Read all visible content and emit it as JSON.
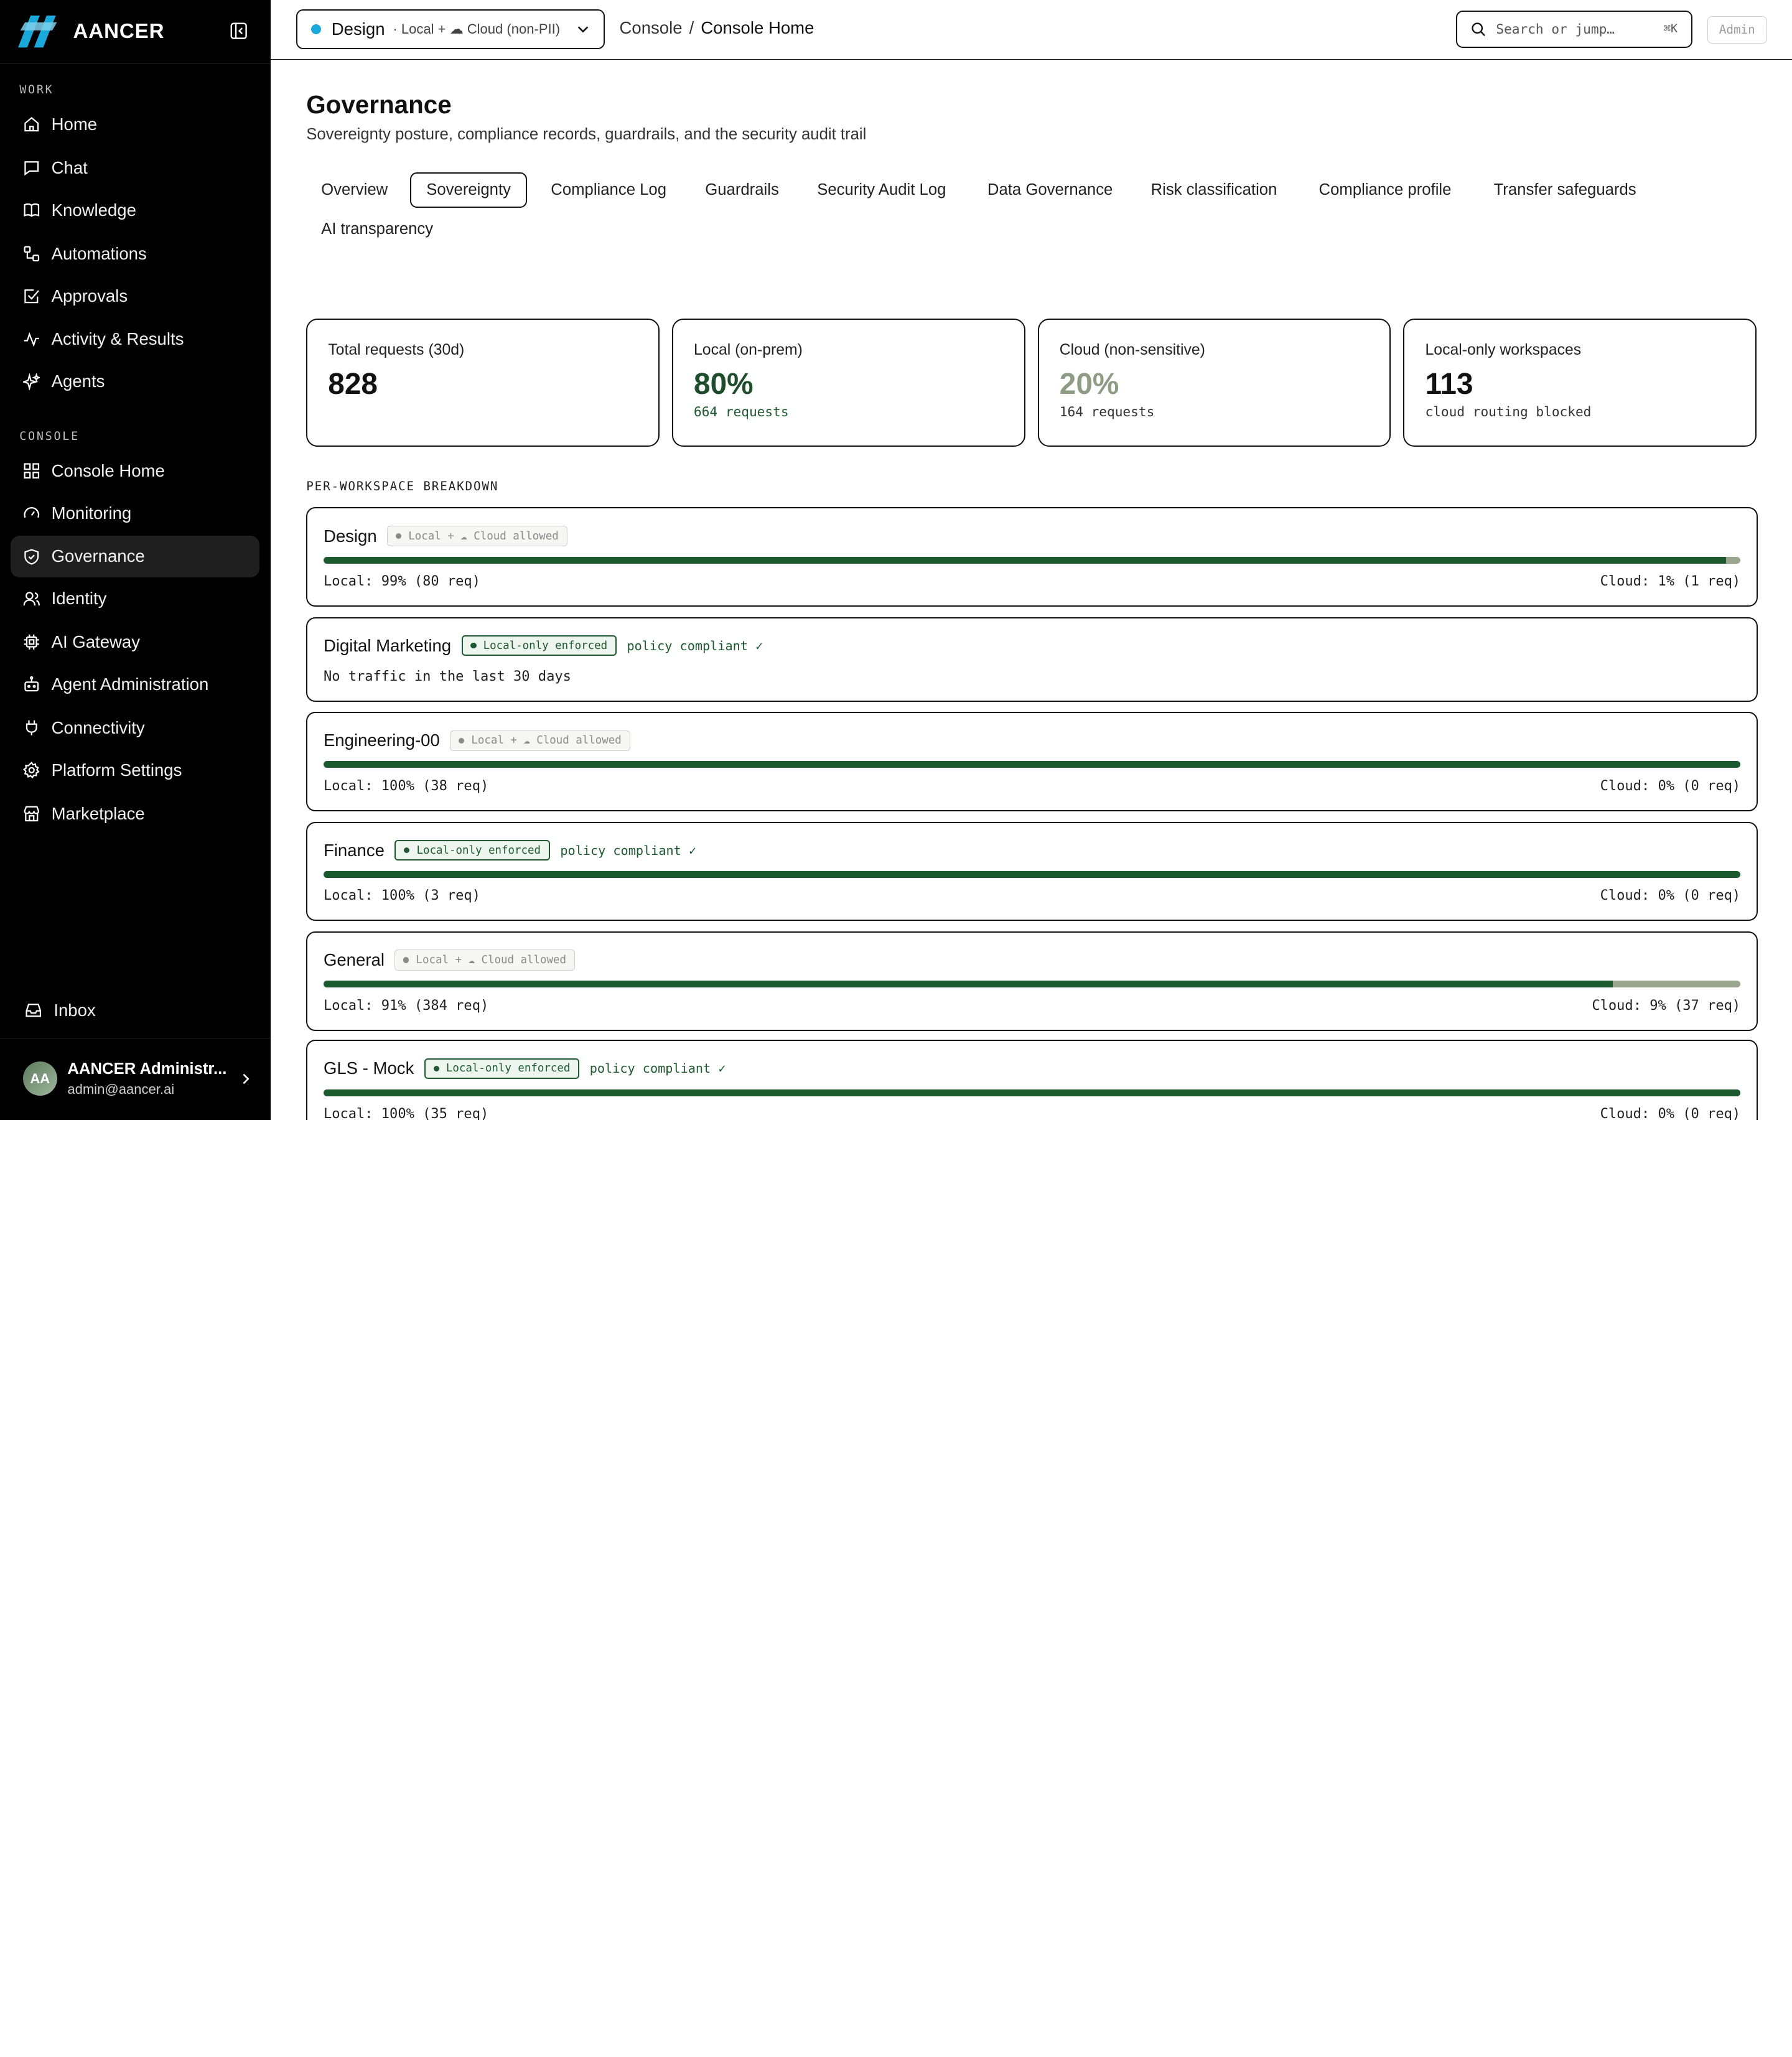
{
  "brand": {
    "name": "AANCER"
  },
  "sidebar": {
    "work_label": "WORK",
    "console_label": "CONSOLE",
    "work_items": [
      {
        "label": "Home",
        "icon": "home-icon"
      },
      {
        "label": "Chat",
        "icon": "chat-icon"
      },
      {
        "label": "Knowledge",
        "icon": "book-icon"
      },
      {
        "label": "Automations",
        "icon": "workflow-icon"
      },
      {
        "label": "Approvals",
        "icon": "check-square-icon"
      },
      {
        "label": "Activity & Results",
        "icon": "activity-icon"
      },
      {
        "label": "Agents",
        "icon": "sparkles-icon"
      }
    ],
    "console_items": [
      {
        "label": "Console Home",
        "icon": "grid-icon"
      },
      {
        "label": "Monitoring",
        "icon": "gauge-icon"
      },
      {
        "label": "Governance",
        "icon": "shield-icon",
        "active": true
      },
      {
        "label": "Identity",
        "icon": "users-icon"
      },
      {
        "label": "AI Gateway",
        "icon": "chip-icon"
      },
      {
        "label": "Agent Administration",
        "icon": "bot-icon"
      },
      {
        "label": "Connectivity",
        "icon": "plug-icon"
      },
      {
        "label": "Platform Settings",
        "icon": "gear-icon"
      },
      {
        "label": "Marketplace",
        "icon": "store-icon"
      }
    ],
    "inbox": {
      "label": "Inbox",
      "icon": "inbox-icon"
    },
    "user": {
      "initials": "AA",
      "name": "AANCER Administr...",
      "email": "admin@aancer.ai"
    }
  },
  "topbar": {
    "workspace": {
      "name": "Design",
      "mode": "· Local + ☁ Cloud (non-PII)",
      "dot_color": "#1aa7d9"
    },
    "breadcrumb": {
      "parent": "Console",
      "separator": "/",
      "current": "Console Home"
    },
    "search": {
      "placeholder": "Search or jump…",
      "shortcut": "⌘K"
    },
    "role_badge": "Admin"
  },
  "page": {
    "title": "Governance",
    "subtitle": "Sovereignty posture, compliance records, guardrails, and the security audit trail",
    "tabs": [
      {
        "label": "Overview"
      },
      {
        "label": "Sovereignty",
        "active": true
      },
      {
        "label": "Compliance Log"
      },
      {
        "label": "Guardrails"
      },
      {
        "label": "Security Audit Log"
      },
      {
        "label": "Data Governance"
      },
      {
        "label": "Risk classification"
      },
      {
        "label": "Compliance profile"
      },
      {
        "label": "Transfer safeguards"
      },
      {
        "label": "AI transparency"
      }
    ]
  },
  "stats": [
    {
      "label": "Total requests (30d)",
      "value": "828",
      "sub": ""
    },
    {
      "label": "Local (on-prem)",
      "value": "80%",
      "sub": "664 requests",
      "tone": "green"
    },
    {
      "label": "Cloud (non-sensitive)",
      "value": "20%",
      "sub": "164 requests",
      "tone": "sage"
    },
    {
      "label": "Local-only workspaces",
      "value": "113",
      "sub": "cloud routing blocked"
    }
  ],
  "breakdown": {
    "label": "PER-WORKSPACE BREAKDOWN",
    "workspaces": [
      {
        "name": "Design",
        "policy": "Local + ☁ Cloud allowed",
        "enforced": false,
        "local_fraction": 0.99,
        "local_text": "Local: 99% (80 req)",
        "cloud_text": "Cloud: 1% (1 req)"
      },
      {
        "name": "Digital Marketing",
        "policy": "Local-only enforced",
        "enforced": true,
        "compliant": "policy compliant ✓",
        "note": "No traffic in the last 30 days"
      },
      {
        "name": "Engineering-00",
        "policy": "Local + ☁ Cloud allowed",
        "enforced": false,
        "local_fraction": 1.0,
        "local_text": "Local: 100% (38 req)",
        "cloud_text": "Cloud: 0% (0 req)"
      },
      {
        "name": "Finance",
        "policy": "Local-only enforced",
        "enforced": true,
        "compliant": "policy compliant ✓",
        "local_fraction": 1.0,
        "local_text": "Local: 100% (3 req)",
        "cloud_text": "Cloud: 0% (0 req)"
      },
      {
        "name": "General",
        "policy": "Local + ☁ Cloud allowed",
        "enforced": false,
        "local_fraction": 0.91,
        "local_text": "Local: 91% (384 req)",
        "cloud_text": "Cloud: 9% (37 req)"
      },
      {
        "name": "GLS - Mock",
        "policy": "Local-only enforced",
        "enforced": true,
        "compliant": "policy compliant ✓",
        "local_fraction": 1.0,
        "local_text": "Local: 100% (35 req)",
        "cloud_text": "Cloud: 0% (0 req)"
      }
    ]
  }
}
